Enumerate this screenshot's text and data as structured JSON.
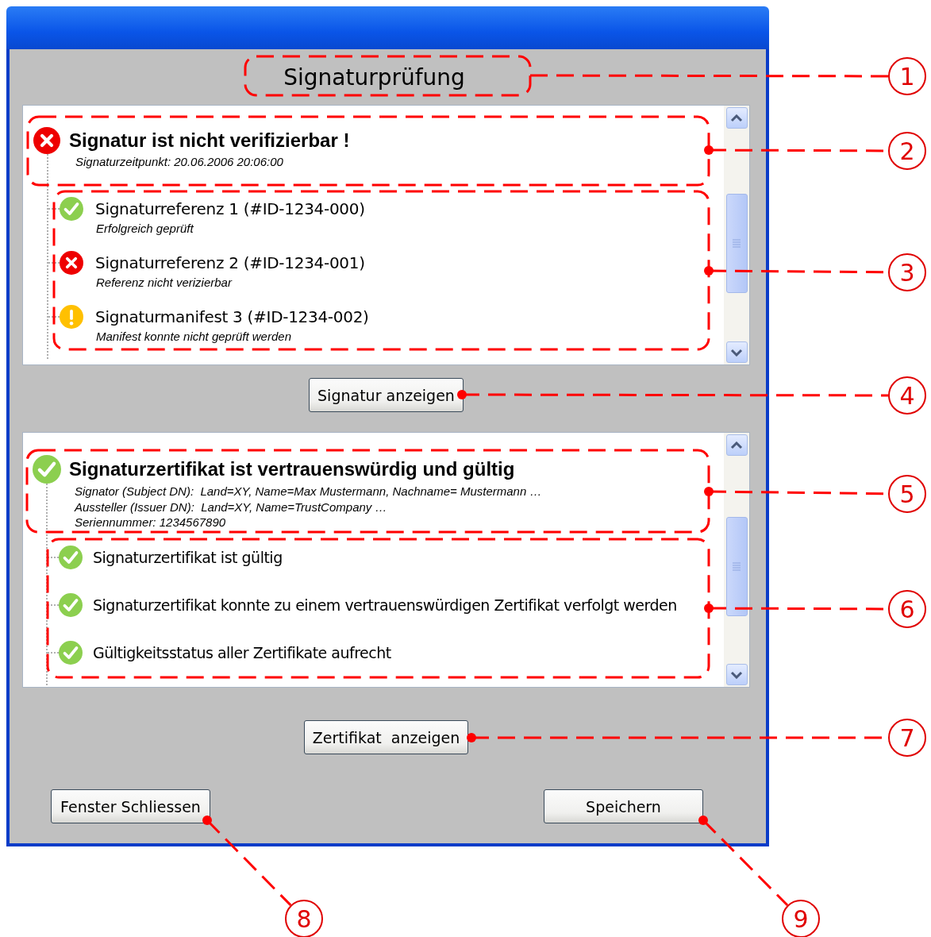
{
  "window": {
    "title": "Signaturprüfung"
  },
  "signature_panel": {
    "kind": "error",
    "title": "Signatur ist nicht verifizierbar !",
    "details": [
      "Signaturzeitpunkt: 20.06.2006 20:06:00"
    ],
    "children": [
      {
        "kind": "ok",
        "title": "Signaturreferenz 1 (#ID-1234-000)",
        "subtitle": "Erfolgreich geprüft"
      },
      {
        "kind": "error",
        "title": "Signaturreferenz 2 (#ID-1234-001)",
        "subtitle": "Referenz nicht verizierbar"
      },
      {
        "kind": "warning",
        "title": "Signaturmanifest 3 (#ID-1234-002)",
        "subtitle": "Manifest konnte nicht geprüft werden"
      }
    ]
  },
  "show_signature_button": "Signatur anzeigen",
  "certificate_panel": {
    "kind": "ok",
    "title": "Signaturzertifikat ist vertrauenswürdig und gültig",
    "details": [
      "Signator (Subject DN):  Land=XY, Name=Max Mustermann, Nachname= Mustermann …",
      "Aussteller (Issuer DN):  Land=XY, Name=TrustCompany …",
      "Seriennummer: 1234567890"
    ],
    "children": [
      {
        "kind": "ok",
        "title": "Signaturzertifikat ist gültig"
      },
      {
        "kind": "ok",
        "title": "Signaturzertifikat konnte zu einem vertrauenswürdigen Zertifikat verfolgt werden"
      },
      {
        "kind": "ok",
        "title": "Gültigkeitsstatus aller Zertifikate aufrecht"
      }
    ]
  },
  "show_certificate_button": "Zertifikat  anzeigen",
  "buttons": [
    "Fenster Schliessen",
    "Speichern"
  ],
  "callouts": [
    "1",
    "2",
    "3",
    "4",
    "5",
    "6",
    "7",
    "8",
    "9"
  ]
}
